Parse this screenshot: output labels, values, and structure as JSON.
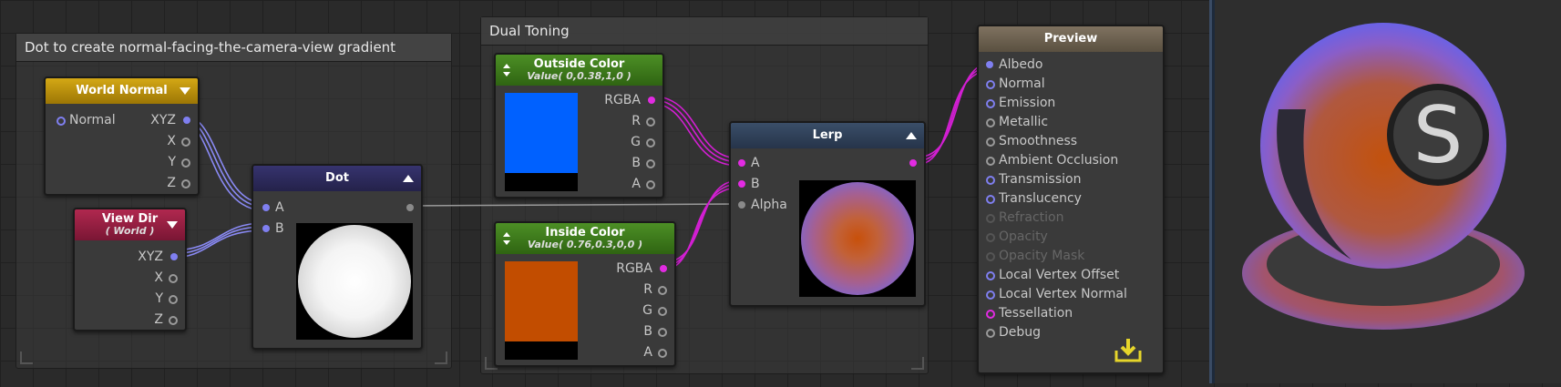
{
  "groups": {
    "dot_group": {
      "title": "Dot to create normal-facing-the-camera-view gradient"
    },
    "dual_group": {
      "title": "Dual Toning"
    }
  },
  "nodes": {
    "world_normal": {
      "title": "World Normal",
      "color": "#b18a0a",
      "inputs": [
        {
          "label": "Normal"
        }
      ],
      "outputs": [
        {
          "label": "XYZ"
        },
        {
          "label": "X"
        },
        {
          "label": "Y"
        },
        {
          "label": "Z"
        }
      ]
    },
    "view_dir": {
      "title": "View Dir",
      "subtitle": "( World )",
      "color": "#8a1d3e",
      "outputs": [
        {
          "label": "XYZ"
        },
        {
          "label": "X"
        },
        {
          "label": "Y"
        },
        {
          "label": "Z"
        }
      ]
    },
    "dot": {
      "title": "Dot",
      "color": "#2c2a5a",
      "inputs": [
        {
          "label": "A"
        },
        {
          "label": "B"
        }
      ]
    },
    "outside_color": {
      "title": "Outside Color",
      "subtitle": "Value( 0,0.38,1,0 )",
      "color": "#3f7a1e",
      "swatch": "#0061ff",
      "outputs": [
        {
          "label": "RGBA"
        },
        {
          "label": "R"
        },
        {
          "label": "G"
        },
        {
          "label": "B"
        },
        {
          "label": "A"
        }
      ]
    },
    "inside_color": {
      "title": "Inside Color",
      "subtitle": "Value( 0.76,0.3,0,0 )",
      "color": "#3f7a1e",
      "swatch": "#c24d00",
      "outputs": [
        {
          "label": "RGBA"
        },
        {
          "label": "R"
        },
        {
          "label": "G"
        },
        {
          "label": "B"
        },
        {
          "label": "A"
        }
      ]
    },
    "lerp": {
      "title": "Lerp",
      "color": "#2c3c52",
      "inputs": [
        {
          "label": "A"
        },
        {
          "label": "B"
        },
        {
          "label": "Alpha"
        }
      ]
    },
    "preview": {
      "title": "Preview",
      "color": "#6e6354",
      "inputs": [
        {
          "label": "Albedo",
          "state": "connected"
        },
        {
          "label": "Normal",
          "state": "enabled"
        },
        {
          "label": "Emission",
          "state": "enabled"
        },
        {
          "label": "Metallic",
          "state": "enabled-grey"
        },
        {
          "label": "Smoothness",
          "state": "enabled-grey"
        },
        {
          "label": "Ambient Occlusion",
          "state": "enabled-grey"
        },
        {
          "label": "Transmission",
          "state": "enabled"
        },
        {
          "label": "Translucency",
          "state": "enabled"
        },
        {
          "label": "Refraction",
          "state": "disabled"
        },
        {
          "label": "Opacity",
          "state": "disabled"
        },
        {
          "label": "Opacity Mask",
          "state": "disabled"
        },
        {
          "label": "Local Vertex Offset",
          "state": "enabled"
        },
        {
          "label": "Local Vertex Normal",
          "state": "enabled"
        },
        {
          "label": "Tessellation",
          "state": "enabled-mag"
        },
        {
          "label": "Debug",
          "state": "enabled-grey"
        }
      ]
    }
  },
  "colors": {
    "wire_blue": "#8a8af5",
    "wire_magenta": "#d21fd2",
    "wire_grey": "#9a9a9a",
    "material_purple": "#7b57d6",
    "material_orange": "#c2520e"
  },
  "icons": {
    "save": "download-icon",
    "logo": "s-logo-icon"
  },
  "preview_logo": "S"
}
